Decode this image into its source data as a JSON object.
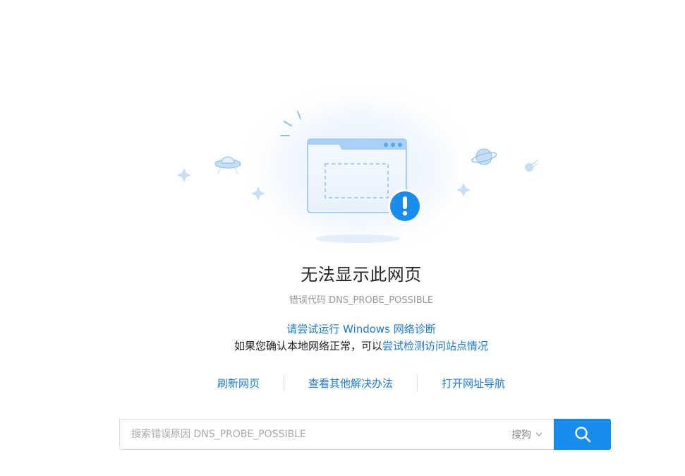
{
  "error": {
    "title": "无法显示此网页",
    "code_text": "错误代码 DNS_PROBE_POSSIBLE"
  },
  "help": {
    "diagnose_link": "请尝试运行 Windows 网络诊断",
    "local_text": "如果您确认本地网络正常，可以",
    "detect_link": "尝试检测访问站点情况"
  },
  "actions": {
    "refresh": "刷新网页",
    "other_solutions": "查看其他解决办法",
    "open_nav": "打开网址导航"
  },
  "search": {
    "placeholder": "搜索错误原因 DNS_PROBE_POSSIBLE",
    "engine": "搜狗"
  },
  "colors": {
    "accent": "#1a8cf0",
    "link": "#1a7ad6",
    "alert": "#1a8cf0"
  },
  "icons": {
    "illustration": "broken-browser-window-illustration",
    "alert": "exclamation-circle-icon",
    "search": "search-icon",
    "dropdown": "chevron-down-icon"
  }
}
